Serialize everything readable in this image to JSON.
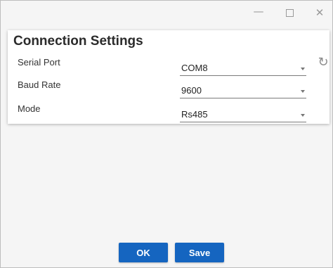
{
  "window_controls": {
    "minimize": "—",
    "close": "✕"
  },
  "card": {
    "title": "Connection Settings"
  },
  "fields": {
    "serial_port": {
      "label": "Serial Port",
      "value": "COM8"
    },
    "baud_rate": {
      "label": "Baud Rate",
      "value": "9600"
    },
    "mode": {
      "label": "Mode",
      "value": "Rs485"
    }
  },
  "icons": {
    "refresh": "↻"
  },
  "buttons": {
    "ok": "OK",
    "save": "Save"
  },
  "colors": {
    "primary_button": "#1565c0"
  }
}
